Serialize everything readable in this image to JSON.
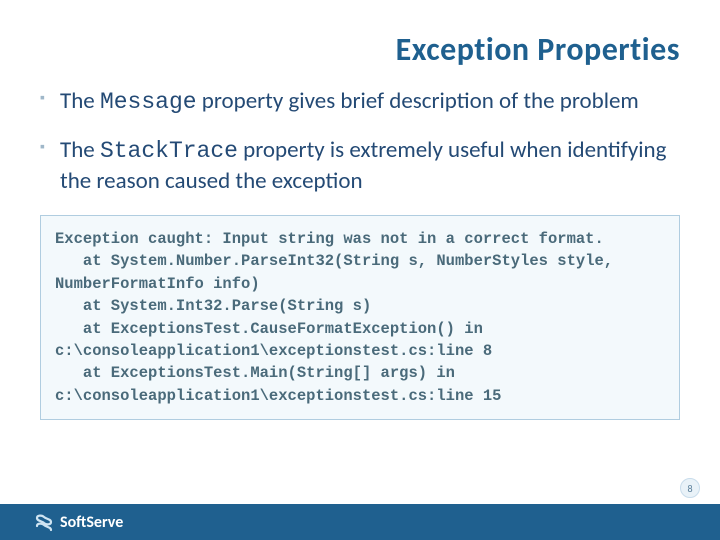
{
  "title": "Exception Properties",
  "bullets": [
    {
      "pre": "The ",
      "mono": "Message",
      "post": " property gives brief description of the problem"
    },
    {
      "pre": "The ",
      "mono": "StackTrace",
      "post": " property is extremely useful when identifying the reason caused the exception"
    }
  ],
  "code": "Exception caught: Input string was not in a correct format.\n   at System.Number.ParseInt32(String s, NumberStyles style, NumberFormatInfo info)\n   at System.Int32.Parse(String s)\n   at ExceptionsTest.CauseFormatException() in c:\\consoleapplication1\\exceptionstest.cs:line 8\n   at ExceptionsTest.Main(String[] args) in c:\\consoleapplication1\\exceptionstest.cs:line 15",
  "footer": {
    "brand": "SoftServe"
  },
  "page_number": "8"
}
